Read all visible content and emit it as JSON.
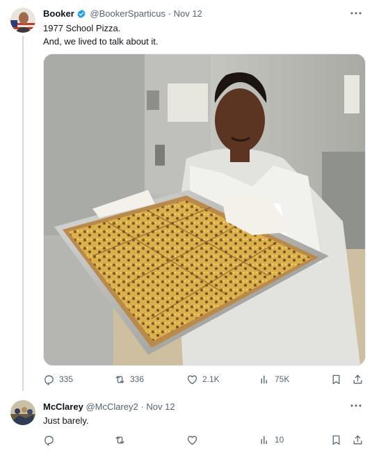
{
  "tweet": {
    "author_name": "Booker",
    "handle": "@BookerSparticus",
    "separator": "·",
    "date": "Nov 12",
    "text_line1": "1977 School Pizza.",
    "text_line2": "And, we lived to talk about it.",
    "stats": {
      "replies": "335",
      "reposts": "336",
      "likes": "2.1K",
      "views": "75K"
    }
  },
  "reply": {
    "author_name": "McClarey",
    "handle": "@McClarey2",
    "separator": "·",
    "date": "Nov 12",
    "text": "Just barely.",
    "stats": {
      "replies": "",
      "reposts": "",
      "likes": "",
      "views": "10"
    }
  },
  "colors": {
    "verified": "#1d9bf0",
    "muted": "#536471",
    "thread_line": "#cfd9de"
  },
  "icons": [
    "more-icon",
    "verified-icon",
    "reply-icon",
    "repost-icon",
    "like-icon",
    "views-icon",
    "bookmark-icon",
    "share-icon"
  ]
}
